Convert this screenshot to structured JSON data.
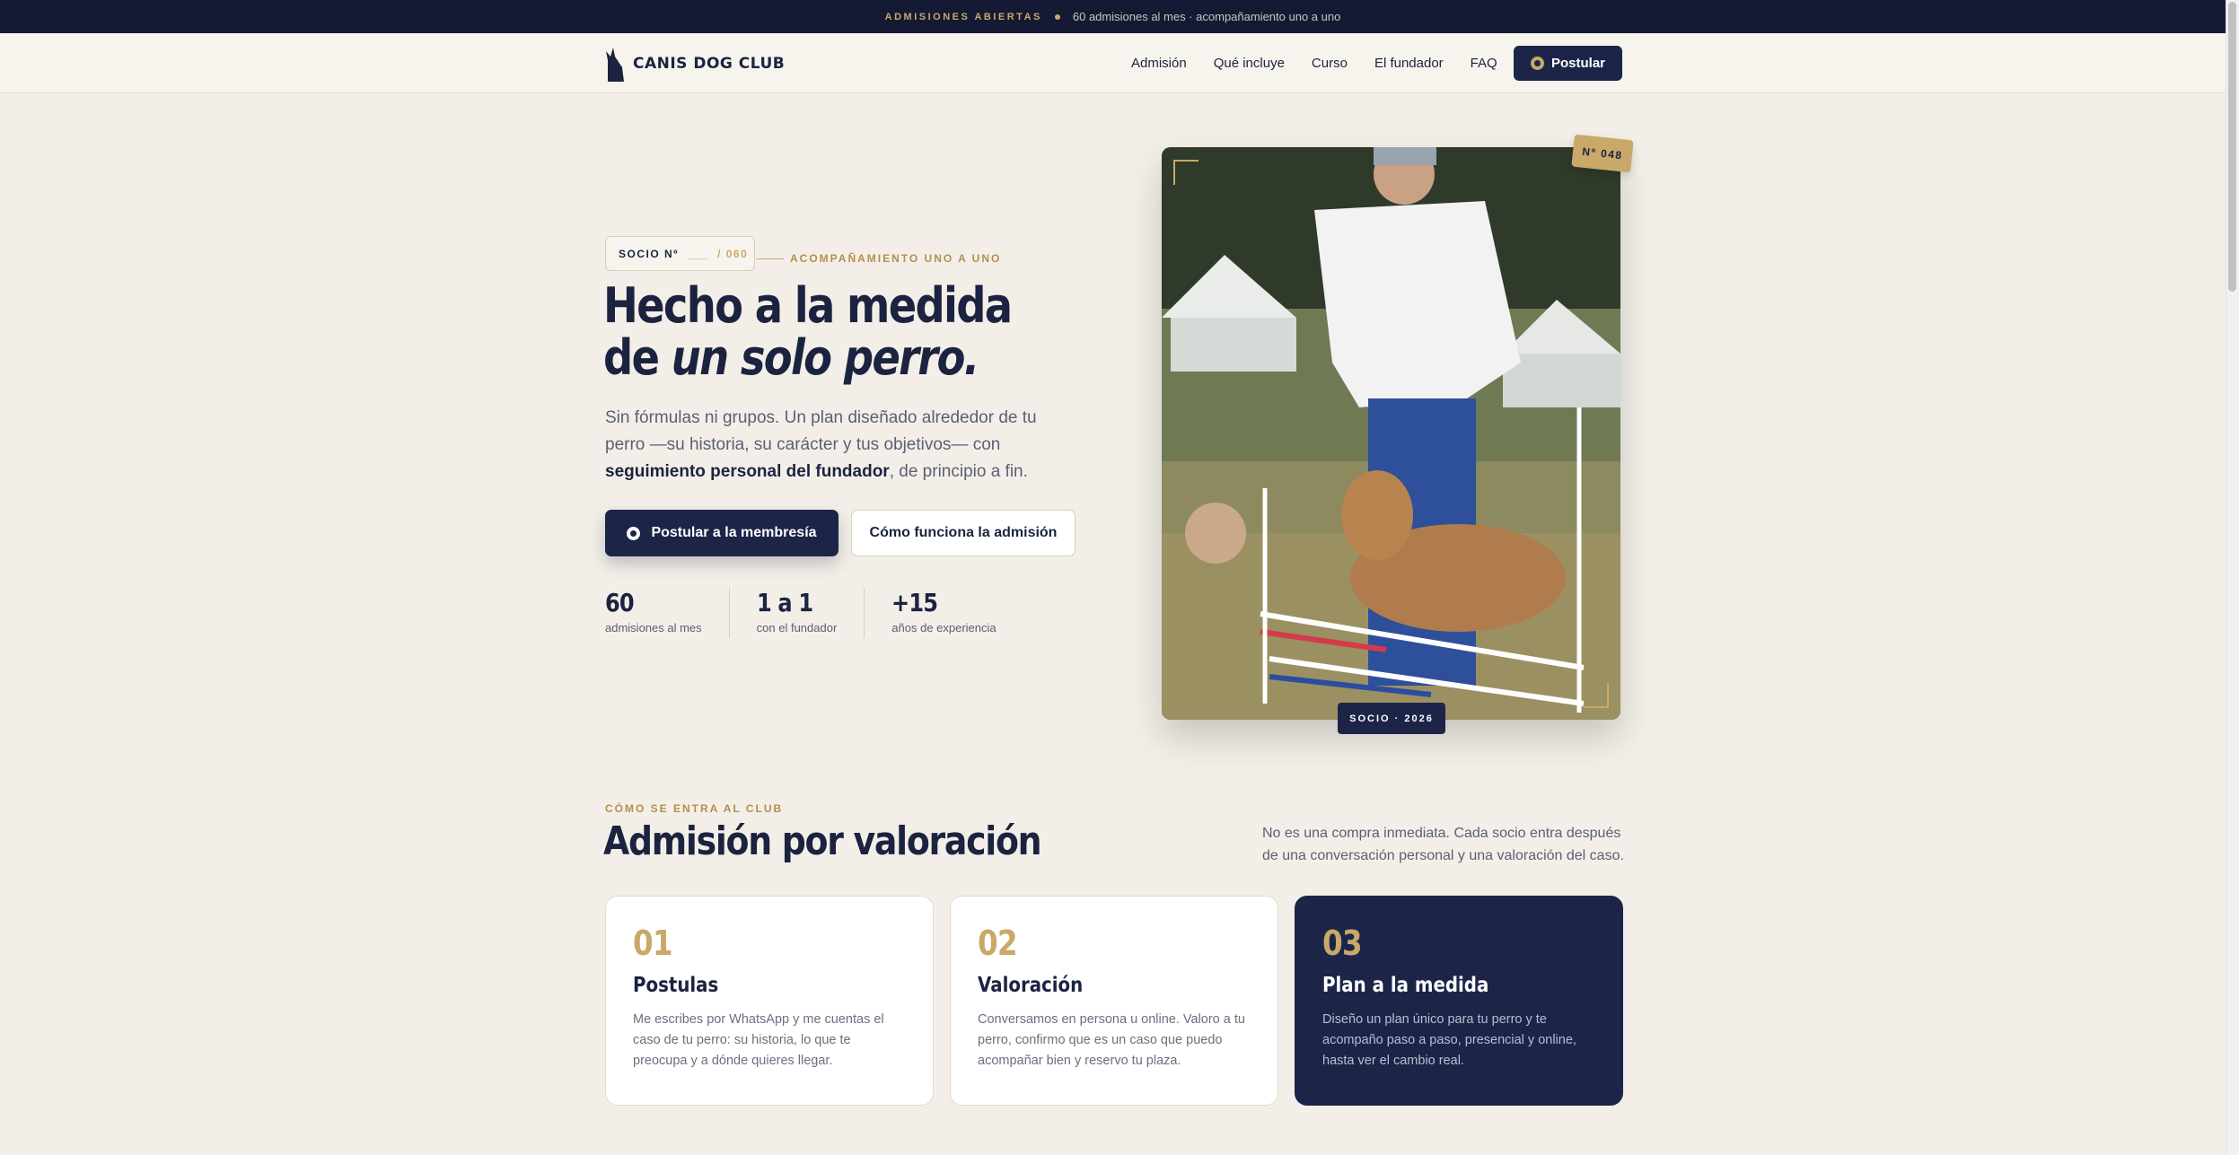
{
  "topbar": {
    "tag": "ADMISIONES ABIERTAS",
    "text": "60 admisiones al mes · acompañamiento uno a uno"
  },
  "nav": {
    "logo": "CANIS DOG CLUB",
    "links": [
      "Admisión",
      "Qué incluye",
      "Curso",
      "El fundador",
      "FAQ"
    ],
    "cta": "Postular"
  },
  "hero": {
    "socio_label": "SOCIO Nº",
    "socio_blank": "___",
    "socio_total": "/ 060",
    "kicker": "ACOMPAÑAMIENTO UNO A UNO",
    "title_line1": "Hecho a la medida",
    "title_line2_prefix": "de ",
    "title_line2_em": "un solo perro.",
    "lead_text": "Sin fórmulas ni grupos. Un plan diseñado alrededor de tu perro —su historia, su carácter y tus objetivos— con ",
    "lead_strong": "seguimiento personal del fundador",
    "lead_end": ", de principio a fin.",
    "btn_primary": "Postular a la membresía",
    "btn_secondary": "Cómo funciona la admisión",
    "stats": [
      {
        "value": "60",
        "label": "admisiones al mes"
      },
      {
        "value": "1 a 1",
        "label": "con el fundador"
      },
      {
        "value": "+15",
        "label": "años de experiencia"
      }
    ],
    "badge_number": "Nº 048",
    "badge_socio": "SOCIO · 2026"
  },
  "admission": {
    "kicker": "CÓMO SE ENTRA AL CLUB",
    "title": "Admisión por valoración",
    "desc": "No es una compra inmediata. Cada socio entra después de una conversación personal y una valoración del caso.",
    "steps": [
      {
        "num": "01",
        "title": "Postulas",
        "text": "Me escribes por WhatsApp y me cuentas el caso de tu perro: su historia, lo que te preocupa y a dónde quieres llegar."
      },
      {
        "num": "02",
        "title": "Valoración",
        "text": "Conversamos en persona u online. Valoro a tu perro, confirmo que es un caso que puedo acompañar bien y reservo tu plaza."
      },
      {
        "num": "03",
        "title": "Plan a la medida",
        "text": "Diseño un plan único para tu perro y te acompaño paso a paso, presencial y online, hasta ver el cambio real."
      }
    ]
  },
  "colors": {
    "navy": "#1c2548",
    "gold": "#c9a86a",
    "background": "#f3efe8"
  },
  "icons": [
    "dog-logo-icon",
    "whatsapp-icon"
  ]
}
